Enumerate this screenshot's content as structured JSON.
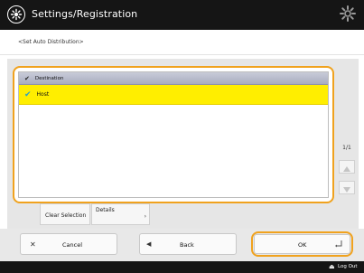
{
  "header": {
    "title": "Settings/Registration",
    "logo_icon": "settings-app-icon",
    "gear_icon": "gear-icon"
  },
  "breadcrumb": "<Set Auto Distribution>",
  "list": {
    "header_label": "Destination",
    "rows": [
      {
        "label": "Host",
        "checked": true
      }
    ]
  },
  "pager": {
    "text": "1/1",
    "up_icon": "arrow-up-icon",
    "down_icon": "arrow-down-icon"
  },
  "actions": {
    "clear_selection": "Clear Selection",
    "details": "Details"
  },
  "buttons": {
    "cancel": "Cancel",
    "back": "Back",
    "ok": "OK"
  },
  "footer": {
    "logout": "Log Out"
  },
  "colors": {
    "accent_orange": "#f0a21e",
    "selected_row": "#ffee00",
    "check_blue": "#2aa0c8",
    "bar_dark": "#151515"
  }
}
